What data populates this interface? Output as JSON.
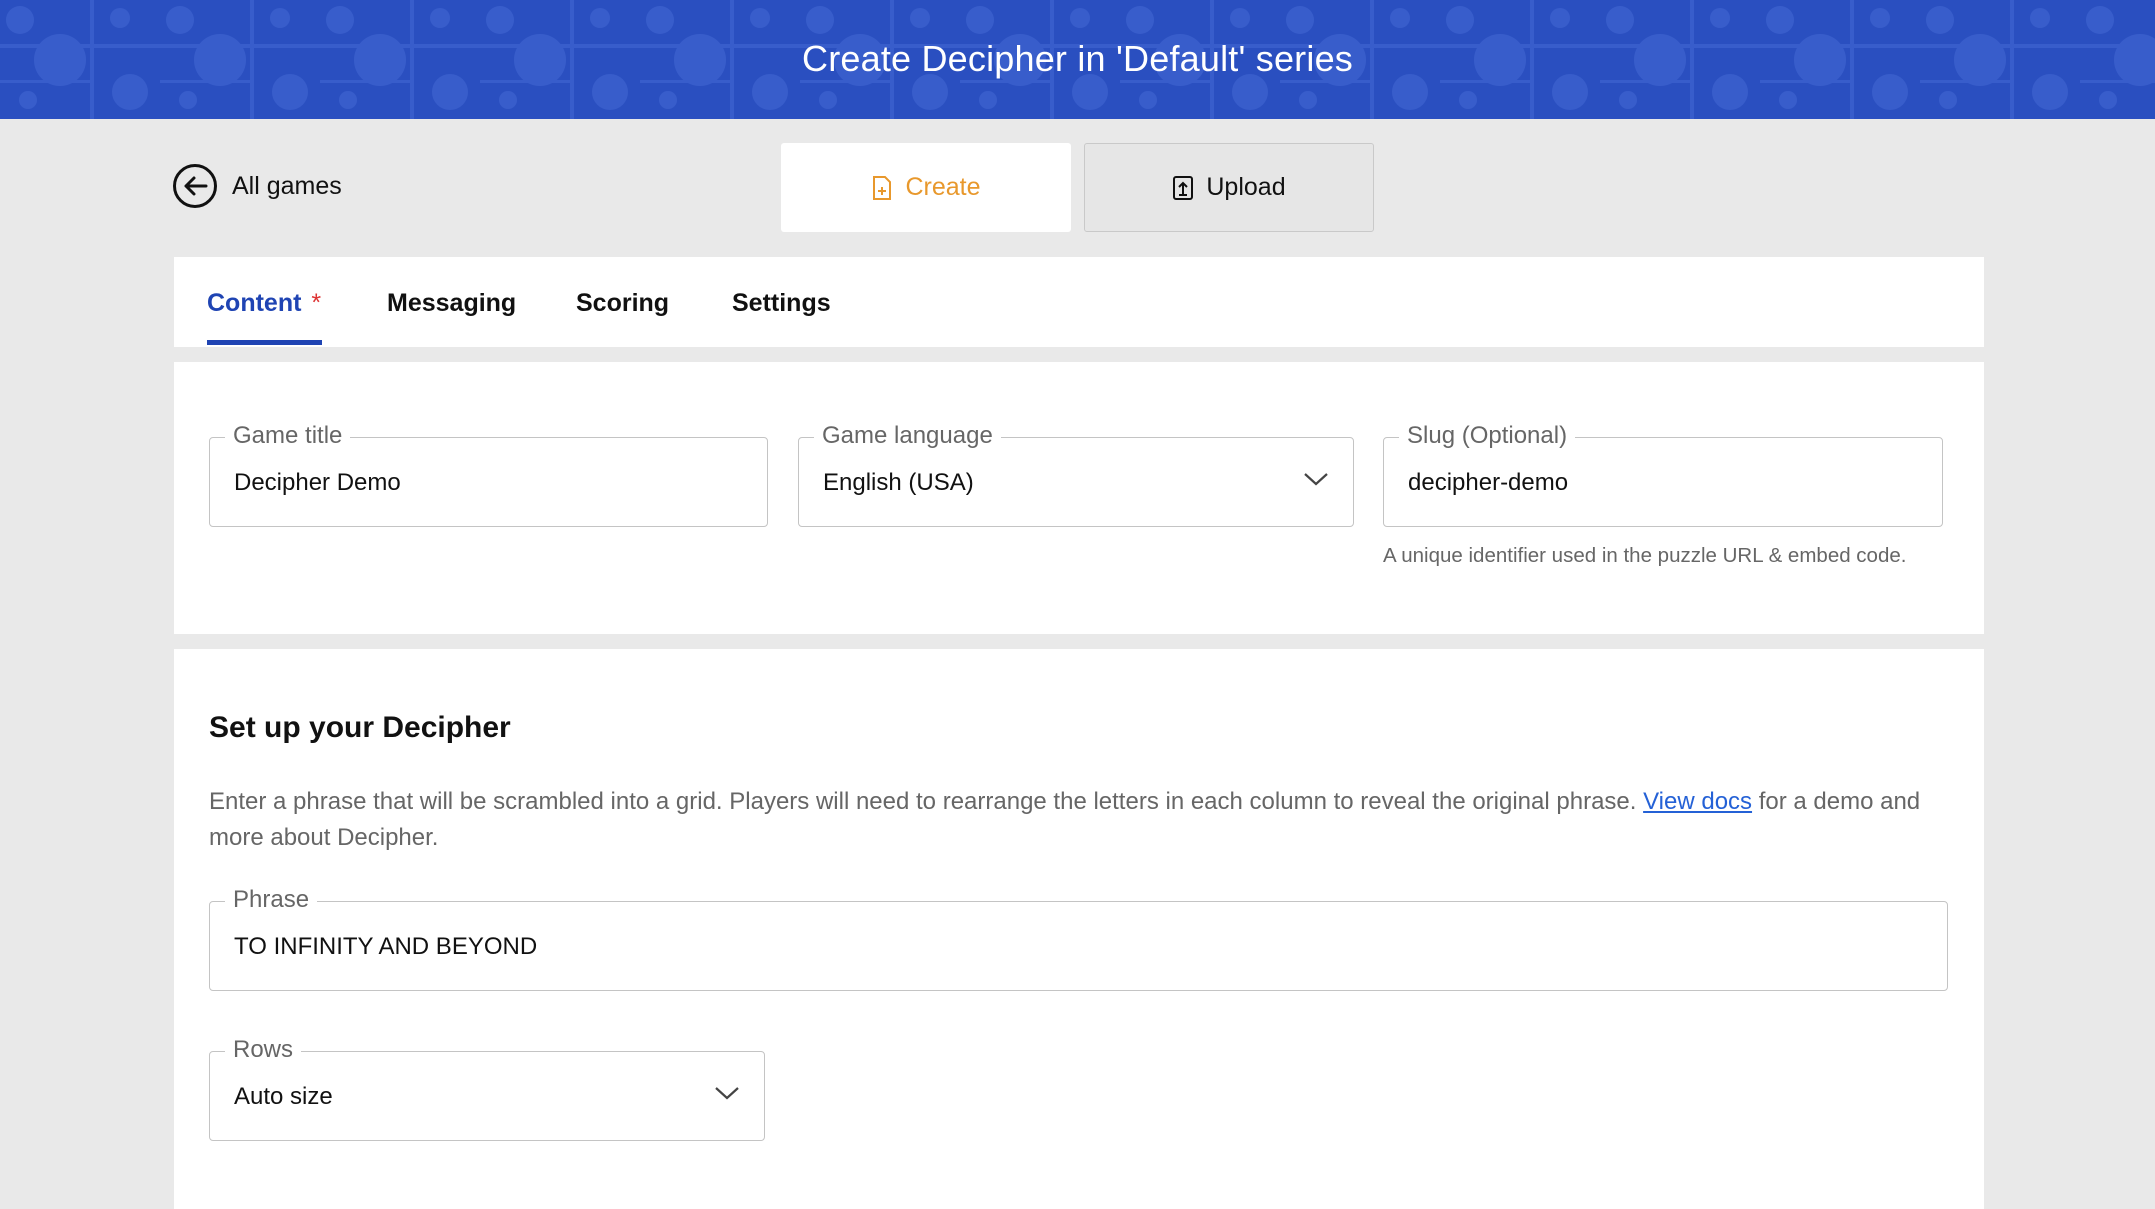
{
  "header": {
    "title": "Create Decipher in 'Default' series"
  },
  "nav": {
    "back_label": "All games"
  },
  "modes": {
    "create_label": "Create",
    "upload_label": "Upload"
  },
  "tabs": [
    {
      "label": "Content",
      "required_marker": "*"
    },
    {
      "label": "Messaging"
    },
    {
      "label": "Scoring"
    },
    {
      "label": "Settings"
    }
  ],
  "basics": {
    "game_title": {
      "label": "Game title",
      "value": "Decipher Demo"
    },
    "game_language": {
      "label": "Game language",
      "value": "English (USA)"
    },
    "slug": {
      "label": "Slug (Optional)",
      "value": "decipher-demo",
      "helper": "A unique identifier used in the puzzle URL & embed code."
    }
  },
  "setup": {
    "title": "Set up your Decipher",
    "description_before": "Enter a phrase that will be scrambled into a grid. Players will need to rearrange the letters in each column to reveal the original phrase. ",
    "docs_link": "View docs",
    "description_after": " for a demo and more about Decipher.",
    "phrase": {
      "label": "Phrase",
      "value": "TO INFINITY AND BEYOND"
    },
    "rows": {
      "label": "Rows",
      "value": "Auto size"
    }
  },
  "colors": {
    "header_bg": "#2a4fc0",
    "accent_blue": "#1f44b3",
    "create_orange": "#e8982c",
    "link_blue": "#2461d6",
    "required_red": "#dd3333"
  },
  "icons": {
    "back": "arrow-left-circle-icon",
    "create": "new-document-icon",
    "upload": "upload-file-icon",
    "dropdown": "chevron-down-icon"
  }
}
